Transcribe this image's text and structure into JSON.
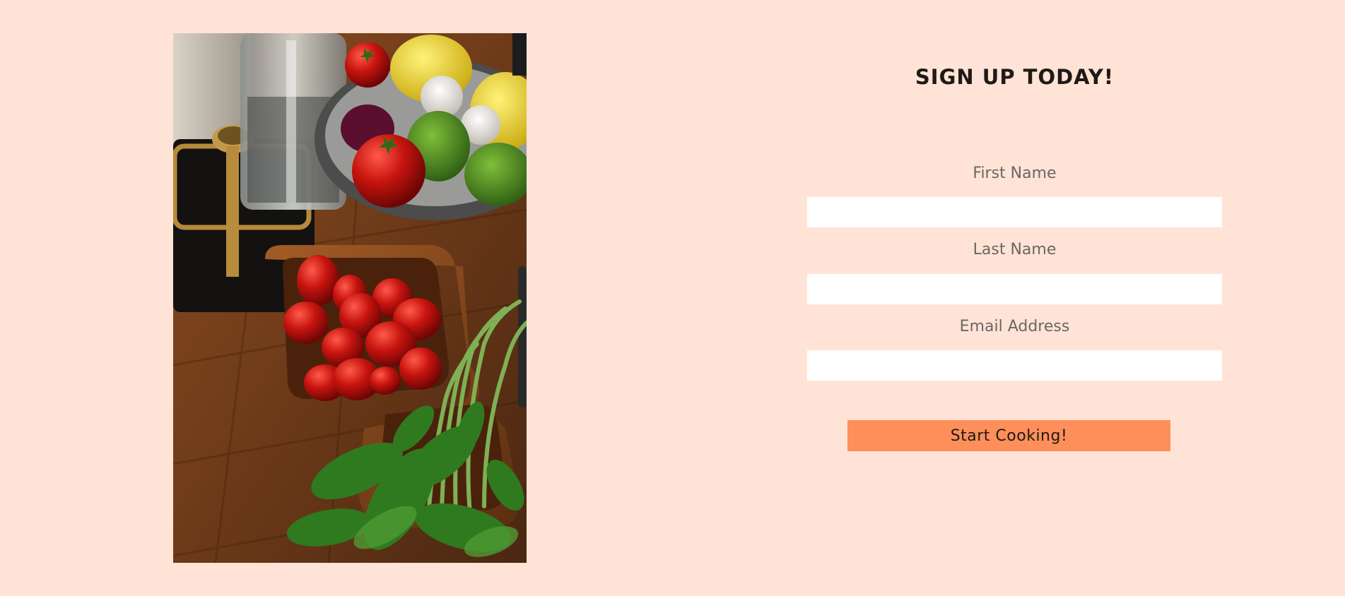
{
  "signup": {
    "title": "SIGN UP TODAY!",
    "fields": [
      {
        "label": "First Name",
        "value": "",
        "placeholder": ""
      },
      {
        "label": "Last Name",
        "value": "",
        "placeholder": ""
      },
      {
        "label": "Email Address",
        "value": "",
        "placeholder": ""
      }
    ],
    "submit_label": "Start Cooking!"
  },
  "colors": {
    "background": "#ffe3d6",
    "button": "#ff8f5a",
    "input": "#ffffff",
    "title_text": "#1f1a17",
    "label_text": "#6b6764"
  }
}
